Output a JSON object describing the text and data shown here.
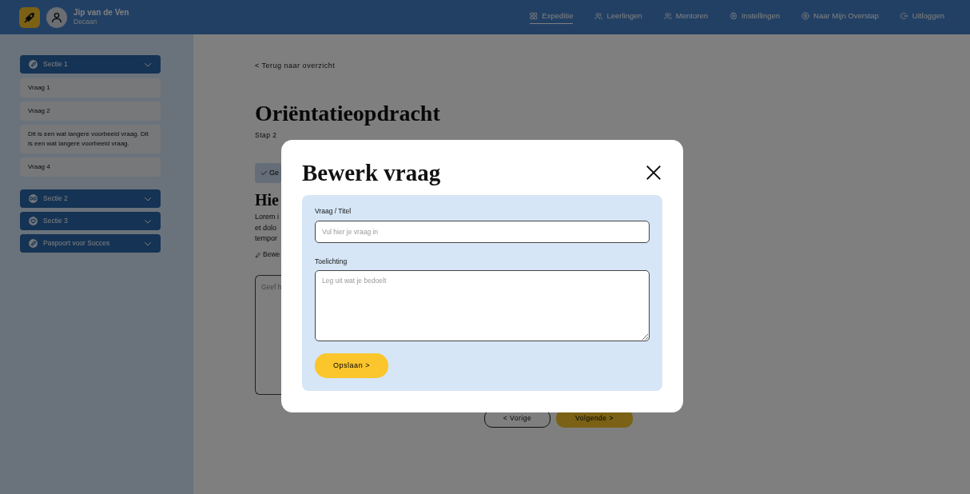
{
  "navbar": {
    "user": {
      "name": "Jip van de Ven",
      "role": "Decaan"
    },
    "links": [
      {
        "label": "Expeditie",
        "selected": true
      },
      {
        "label": "Leerlingen",
        "selected": false
      },
      {
        "label": "Mentoren",
        "selected": false
      },
      {
        "label": "Instellingen",
        "selected": false
      },
      {
        "label": "Naar Mijn Overstap",
        "selected": false
      },
      {
        "label": "Uitloggen",
        "selected": false
      }
    ]
  },
  "sidebar": {
    "sections": [
      {
        "title": "Sectie 1",
        "questions": [
          "Vraag 1",
          "Vraag 2",
          "Dit is een wat langere voorbeeld vraag. Dit is een wat langere voorbeeld vraag.",
          "Vraag 4"
        ]
      },
      {
        "title": "Sectie 2"
      },
      {
        "title": "Sectie 3"
      },
      {
        "title": "Paspoort voor Succes"
      }
    ]
  },
  "main": {
    "back_link": "< Terug naar overzicht",
    "title": "Oriëntatieopdracht",
    "subtitle": "Stap 2",
    "done_button": "Ge",
    "heading": "Hie",
    "body_lines": [
      "Lorem i",
      "et dolo",
      "tempor"
    ],
    "edit_link": "Bewe",
    "answer_placeholder": "Geef h",
    "prev_button": "< Vorige",
    "next_button": "Volgende >"
  },
  "modal": {
    "title": "Bewerk vraag",
    "fields": [
      {
        "kind": "input",
        "label": "Vraag / Titel",
        "placeholder": "Vul hier je vraag in"
      },
      {
        "kind": "textarea",
        "label": "Toelichting",
        "placeholder": "Leg uit wat je bedoelt"
      }
    ],
    "save_button": "Opslaan >"
  }
}
